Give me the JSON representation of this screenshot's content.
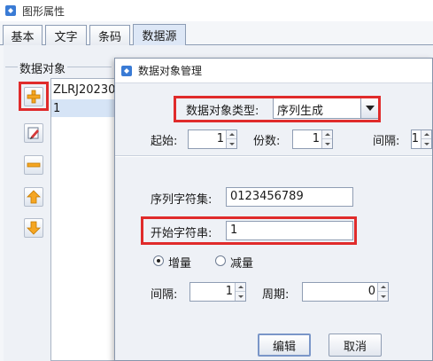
{
  "window": {
    "title": "图形属性"
  },
  "tabs": [
    {
      "label": "基本"
    },
    {
      "label": "文字"
    },
    {
      "label": "条码"
    },
    {
      "label": "数据源",
      "active": true
    }
  ],
  "data_object_panel": {
    "legend": "数据对象",
    "list": [
      {
        "text": "ZLRJ20230"
      },
      {
        "text": "1",
        "selected": true
      }
    ],
    "side_buttons": [
      {
        "icon": "plus-icon"
      },
      {
        "icon": "edit-icon"
      },
      {
        "icon": "minus-icon"
      },
      {
        "icon": "arrow-up-icon"
      },
      {
        "icon": "arrow-down-icon"
      }
    ]
  },
  "dialog": {
    "title": "数据对象管理",
    "type_label": "数据对象类型:",
    "type_value": "序列生成",
    "start_label": "起始:",
    "start_value": "1",
    "copies_label": "份数:",
    "copies_value": "1",
    "interval_label": "间隔:",
    "interval_value": "1",
    "charset_label": "序列字符集:",
    "charset_value": "0123456789",
    "start_char_label": "开始字符串:",
    "start_char_value": "1",
    "increase_label": "增量",
    "decrease_label": "减量",
    "mode_selected": "增量",
    "step_label": "间隔:",
    "step_value": "1",
    "period_label": "周期:",
    "period_value": "0",
    "edit_button": "编辑",
    "cancel_button": "取消"
  },
  "colors": {
    "highlight": "#e02b2b",
    "selection": "#d6e4f6",
    "icon_orange": "#f5a623"
  }
}
